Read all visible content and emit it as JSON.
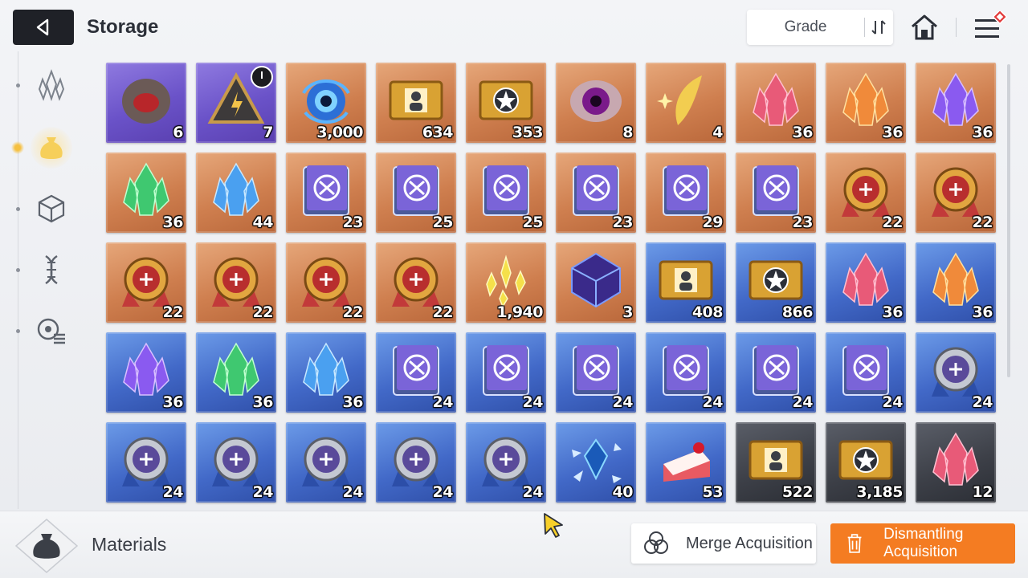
{
  "header": {
    "title": "Storage",
    "grade_label": "Grade"
  },
  "side_nav": [
    {
      "icon": "crystal-cluster-icon",
      "active": false
    },
    {
      "icon": "material-pouch-icon",
      "active": true
    },
    {
      "icon": "cube-icon",
      "active": false
    },
    {
      "icon": "dna-icon",
      "active": false
    },
    {
      "icon": "gear-list-icon",
      "active": false
    }
  ],
  "items": [
    {
      "rarity": "purple",
      "kind": "rock",
      "qty": "6"
    },
    {
      "rarity": "purple",
      "kind": "prism",
      "qty": "7",
      "timer": true
    },
    {
      "rarity": "orange",
      "kind": "orb",
      "qty": "3,000"
    },
    {
      "rarity": "orange",
      "kind": "ticket-char",
      "qty": "634"
    },
    {
      "rarity": "orange",
      "kind": "ticket-star",
      "qty": "353"
    },
    {
      "rarity": "orange",
      "kind": "eye",
      "qty": "8"
    },
    {
      "rarity": "orange",
      "kind": "feather",
      "qty": "4"
    },
    {
      "rarity": "orange",
      "kind": "crystal-red",
      "qty": "36"
    },
    {
      "rarity": "orange",
      "kind": "crystal-orange",
      "qty": "36"
    },
    {
      "rarity": "orange",
      "kind": "crystal-purple",
      "qty": "36"
    },
    {
      "rarity": "orange",
      "kind": "crystal-green",
      "qty": "36"
    },
    {
      "rarity": "orange",
      "kind": "crystal-blue",
      "qty": "44"
    },
    {
      "rarity": "orange",
      "kind": "book",
      "qty": "23"
    },
    {
      "rarity": "orange",
      "kind": "book",
      "qty": "25"
    },
    {
      "rarity": "orange",
      "kind": "book",
      "qty": "25"
    },
    {
      "rarity": "orange",
      "kind": "book",
      "qty": "23"
    },
    {
      "rarity": "orange",
      "kind": "book",
      "qty": "29"
    },
    {
      "rarity": "orange",
      "kind": "book",
      "qty": "23"
    },
    {
      "rarity": "orange",
      "kind": "medal",
      "qty": "22"
    },
    {
      "rarity": "orange",
      "kind": "medal",
      "qty": "22"
    },
    {
      "rarity": "orange",
      "kind": "medal",
      "qty": "22"
    },
    {
      "rarity": "orange",
      "kind": "medal",
      "qty": "22"
    },
    {
      "rarity": "orange",
      "kind": "medal",
      "qty": "22"
    },
    {
      "rarity": "orange",
      "kind": "medal",
      "qty": "22"
    },
    {
      "rarity": "orange",
      "kind": "shards-yellow",
      "qty": "1,940"
    },
    {
      "rarity": "orange",
      "kind": "cube-dark",
      "qty": "3"
    },
    {
      "rarity": "blue",
      "kind": "ticket-char",
      "qty": "408"
    },
    {
      "rarity": "blue",
      "kind": "ticket-star",
      "qty": "866"
    },
    {
      "rarity": "blue",
      "kind": "crystal-red",
      "qty": "36"
    },
    {
      "rarity": "blue",
      "kind": "crystal-orange",
      "qty": "36"
    },
    {
      "rarity": "blue",
      "kind": "crystal-purple",
      "qty": "36"
    },
    {
      "rarity": "blue",
      "kind": "crystal-green",
      "qty": "36"
    },
    {
      "rarity": "blue",
      "kind": "crystal-blue",
      "qty": "36"
    },
    {
      "rarity": "blue",
      "kind": "book",
      "qty": "24"
    },
    {
      "rarity": "blue",
      "kind": "book",
      "qty": "24"
    },
    {
      "rarity": "blue",
      "kind": "book",
      "qty": "24"
    },
    {
      "rarity": "blue",
      "kind": "book",
      "qty": "24"
    },
    {
      "rarity": "blue",
      "kind": "book",
      "qty": "24"
    },
    {
      "rarity": "blue",
      "kind": "book",
      "qty": "24"
    },
    {
      "rarity": "blue",
      "kind": "medal-silver",
      "qty": "24"
    },
    {
      "rarity": "blue",
      "kind": "medal-silver",
      "qty": "24"
    },
    {
      "rarity": "blue",
      "kind": "medal-silver",
      "qty": "24"
    },
    {
      "rarity": "blue",
      "kind": "medal-silver",
      "qty": "24"
    },
    {
      "rarity": "blue",
      "kind": "medal-silver",
      "qty": "24"
    },
    {
      "rarity": "blue",
      "kind": "medal-silver",
      "qty": "24"
    },
    {
      "rarity": "blue",
      "kind": "crystal-shatter",
      "qty": "40"
    },
    {
      "rarity": "blue",
      "kind": "cake",
      "qty": "53"
    },
    {
      "rarity": "gray",
      "kind": "ticket-char",
      "qty": "522"
    },
    {
      "rarity": "gray",
      "kind": "ticket-star",
      "qty": "3,185"
    },
    {
      "rarity": "gray",
      "kind": "crystal-red",
      "qty": "12"
    }
  ],
  "footer": {
    "category_label": "Materials",
    "merge_label": "Merge Acquisition",
    "dismantle_label": "Dismantling Acquisition"
  },
  "colors": {
    "accent_orange": "#f47c22",
    "rarity_purple": "#6a52c8",
    "rarity_orange": "#cf7f4f",
    "rarity_blue": "#4269c8",
    "rarity_gray": "#3d4048"
  }
}
